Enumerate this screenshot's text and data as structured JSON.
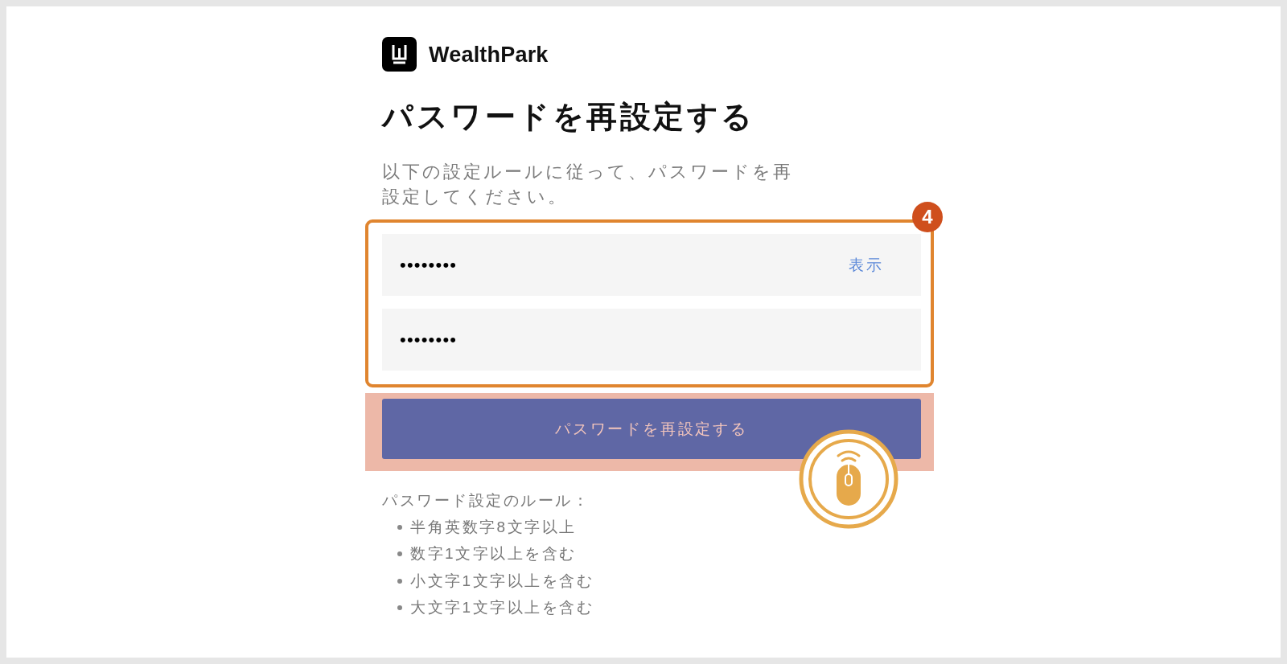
{
  "logo": {
    "name": "WealthPark"
  },
  "title": "パスワードを再設定する",
  "description": "以下の設定ルールに従って、パスワードを再設定してください。",
  "annotation": {
    "step_badge": "4"
  },
  "fields": [
    {
      "value": "••••••••",
      "toggle_label": "表示"
    },
    {
      "value": "••••••••"
    }
  ],
  "submit_button": "パスワードを再設定する",
  "rules": {
    "heading": "パスワード設定のルール：",
    "items": [
      "半角英数字8文字以上",
      "数字1文字以上を含む",
      "小文字1文字以上を含む",
      "大文字1文字以上を含む"
    ]
  }
}
